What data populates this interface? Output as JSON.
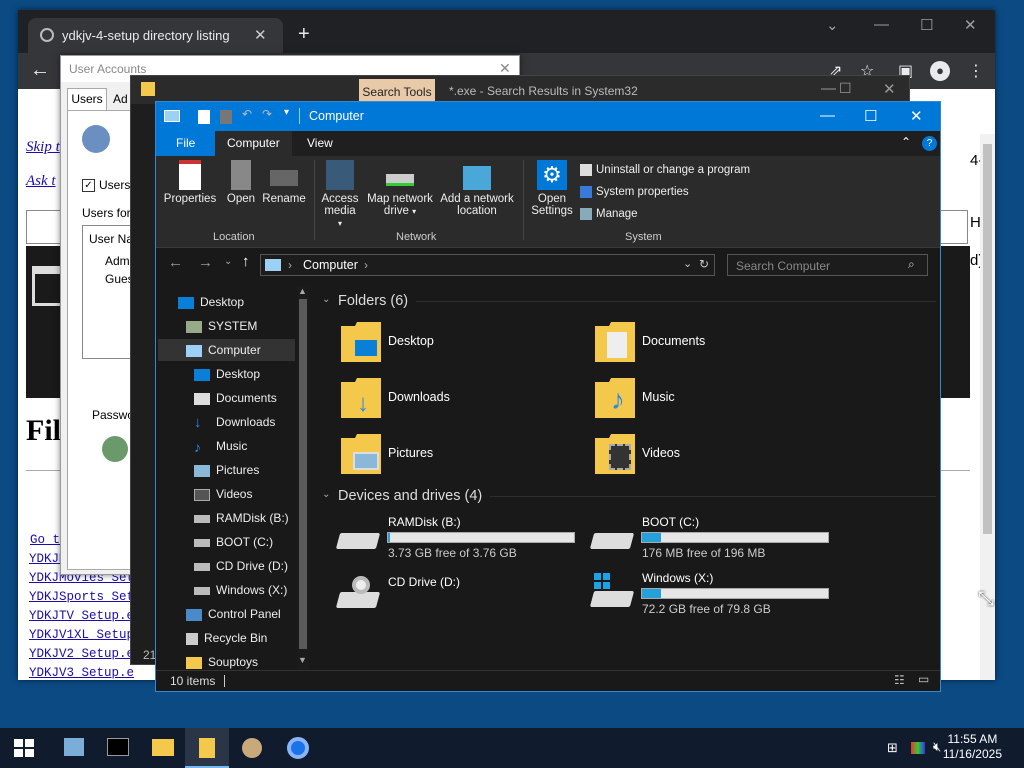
{
  "chrome": {
    "tab_title": "ydkjv-4-setup directory listing",
    "page": {
      "links_top": [
        "Skip t",
        "Ask t"
      ],
      "heading": "Fil",
      "goto_link": "Go t",
      "file_links": [
        "YDKJM",
        "YDKJMovies_Set",
        "YDKJSports_Set",
        "YDKJTV_Setup.e",
        "YDKJV1XL_Setup",
        "YDKJV2_Setup.e",
        "YDKJV3_Setup.e"
      ],
      "right_fragments": [
        "4-",
        "Hz",
        "d)"
      ]
    }
  },
  "user_accounts": {
    "title": "User Accounts",
    "tabs": [
      "Users",
      "Ad"
    ],
    "checkbox_label": "Users",
    "users_for_label": "Users for",
    "column_header": "User Na",
    "users": [
      "Adm",
      "Gues"
    ],
    "password_label": "Passwo"
  },
  "explorer_search": {
    "search_tools_tab": "Search Tools",
    "title": "*.exe - Search Results in System32",
    "status_fragment": "21"
  },
  "explorer": {
    "title": "Computer",
    "tabs": {
      "file": "File",
      "computer": "Computer",
      "view": "View"
    },
    "ribbon": {
      "location": {
        "label": "Location",
        "items": [
          "Properties",
          "Open",
          "Rename"
        ]
      },
      "network": {
        "label": "Network",
        "access_media": "Access media",
        "map_drive": "Map network drive",
        "add_location": "Add a network location"
      },
      "system": {
        "label": "System",
        "open_settings": "Open Settings",
        "uninstall": "Uninstall or change a program",
        "sys_props": "System properties",
        "manage": "Manage"
      }
    },
    "address": {
      "path": "Computer"
    },
    "search_placeholder": "Search Computer",
    "nav_items": [
      "Desktop",
      "SYSTEM",
      "Computer",
      "Desktop",
      "Documents",
      "Downloads",
      "Music",
      "Pictures",
      "Videos",
      "RAMDisk (B:)",
      "BOOT (C:)",
      "CD Drive (D:)",
      "Windows (X:)",
      "Control Panel",
      "Recycle Bin",
      "Souptoys"
    ],
    "folders_header": "Folders (6)",
    "folders": [
      "Desktop",
      "Documents",
      "Downloads",
      "Music",
      "Pictures",
      "Videos"
    ],
    "drives_header": "Devices and drives (4)",
    "drives": [
      {
        "name": "RAMDisk (B:)",
        "free": "3.73 GB free of 3.76 GB",
        "used_fraction": 0.01
      },
      {
        "name": "BOOT (C:)",
        "free": "176 MB free of 196 MB",
        "used_fraction": 0.1
      },
      {
        "name": "CD Drive (D:)",
        "free": "",
        "used_fraction": null
      },
      {
        "name": "Windows (X:)",
        "free": "72.2 GB free of 79.8 GB",
        "used_fraction": 0.1
      }
    ],
    "status": "10 items"
  },
  "taskbar": {
    "time": "11:55 AM",
    "date": "11/16/2025"
  },
  "colors": {
    "accent": "#0078d7",
    "drive_fill": "#26a0da",
    "dark_bg": "#191919"
  }
}
